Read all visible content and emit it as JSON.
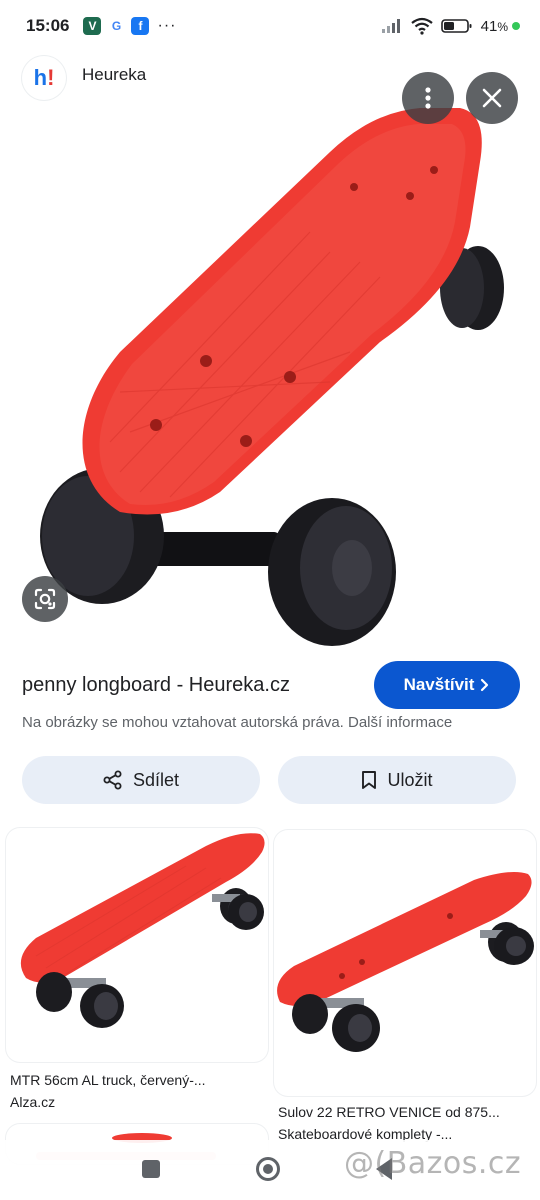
{
  "status_bar": {
    "time": "15:06",
    "app_icons": [
      {
        "name": "vpn-app-icon",
        "glyph": "V",
        "color": "#1e6b4f"
      },
      {
        "name": "google-app-icon",
        "glyph": "G",
        "color": "#ffffff"
      },
      {
        "name": "facebook-app-icon",
        "glyph": "f",
        "color": "#1877f2"
      }
    ],
    "more": "···",
    "battery_percent": "41",
    "battery_unit": "%"
  },
  "source": {
    "favicon_h": "h",
    "favicon_ex": "!",
    "name": "Heureka"
  },
  "result": {
    "title": "penny longboard - Heureka.cz",
    "visit_label": "Navštívit",
    "copyright_note": "Na obrázky se mohou vztahovat autorská práva. Další informace",
    "share_label": "Sdílet",
    "save_label": "Uložit"
  },
  "related": [
    {
      "title": "MTR 56cm AL truck, červený-...",
      "source": "Alza.cz"
    },
    {
      "title": "Sulov 22 RETRO VENICE od 875...",
      "source": "Skateboardové komplety -..."
    }
  ],
  "watermark": "@(Bazos.cz",
  "colors": {
    "accent": "#0b57d0",
    "button_tonal": "#e8eef7",
    "board_red": "#ef3b33",
    "wheel_black": "#1c1c20"
  }
}
